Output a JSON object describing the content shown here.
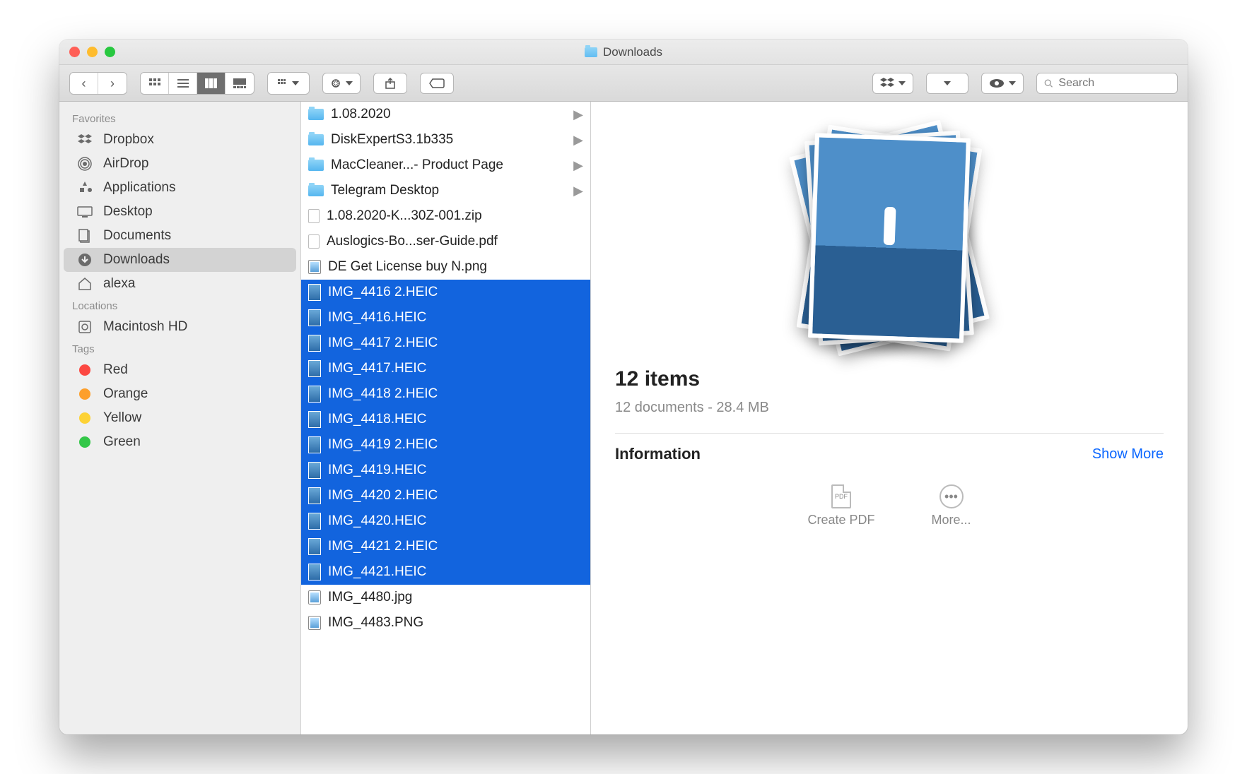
{
  "window": {
    "title": "Downloads"
  },
  "toolbar": {
    "search_placeholder": "Search"
  },
  "sidebar": {
    "sections": [
      {
        "label": "Favorites",
        "items": [
          {
            "label": "Dropbox",
            "icon": "dropbox"
          },
          {
            "label": "AirDrop",
            "icon": "airdrop"
          },
          {
            "label": "Applications",
            "icon": "apps"
          },
          {
            "label": "Desktop",
            "icon": "desktop"
          },
          {
            "label": "Documents",
            "icon": "documents"
          },
          {
            "label": "Downloads",
            "icon": "downloads",
            "active": true
          },
          {
            "label": "alexa",
            "icon": "home"
          }
        ]
      },
      {
        "label": "Locations",
        "items": [
          {
            "label": "Macintosh HD",
            "icon": "disk"
          }
        ]
      },
      {
        "label": "Tags",
        "items": [
          {
            "label": "Red",
            "icon": "tag",
            "color": "#fc4842"
          },
          {
            "label": "Orange",
            "icon": "tag",
            "color": "#fd9f2b"
          },
          {
            "label": "Yellow",
            "icon": "tag",
            "color": "#fdd235"
          },
          {
            "label": "Green",
            "icon": "tag",
            "color": "#33c748"
          }
        ]
      }
    ]
  },
  "files": [
    {
      "name": "1.08.2020",
      "type": "folder",
      "hasChildren": true
    },
    {
      "name": "DiskExpertS3.1b335",
      "type": "folder",
      "hasChildren": true
    },
    {
      "name": "MacCleaner...- Product Page",
      "type": "folder",
      "hasChildren": true
    },
    {
      "name": "Telegram Desktop",
      "type": "folder",
      "hasChildren": true
    },
    {
      "name": "1.08.2020-K...30Z-001.zip",
      "type": "zip"
    },
    {
      "name": "Auslogics-Bo...ser-Guide.pdf",
      "type": "pdf"
    },
    {
      "name": "DE Get License buy N.png",
      "type": "png"
    },
    {
      "name": "IMG_4416 2.HEIC",
      "type": "heic",
      "selected": true
    },
    {
      "name": "IMG_4416.HEIC",
      "type": "heic",
      "selected": true
    },
    {
      "name": "IMG_4417 2.HEIC",
      "type": "heic",
      "selected": true
    },
    {
      "name": "IMG_4417.HEIC",
      "type": "heic",
      "selected": true
    },
    {
      "name": "IMG_4418 2.HEIC",
      "type": "heic",
      "selected": true
    },
    {
      "name": "IMG_4418.HEIC",
      "type": "heic",
      "selected": true
    },
    {
      "name": "IMG_4419 2.HEIC",
      "type": "heic",
      "selected": true
    },
    {
      "name": "IMG_4419.HEIC",
      "type": "heic",
      "selected": true
    },
    {
      "name": "IMG_4420 2.HEIC",
      "type": "heic",
      "selected": true
    },
    {
      "name": "IMG_4420.HEIC",
      "type": "heic",
      "selected": true
    },
    {
      "name": "IMG_4421 2.HEIC",
      "type": "heic",
      "selected": true
    },
    {
      "name": "IMG_4421.HEIC",
      "type": "heic",
      "selected": true
    },
    {
      "name": "IMG_4480.jpg",
      "type": "jpg"
    },
    {
      "name": "IMG_4483.PNG",
      "type": "png"
    }
  ],
  "preview": {
    "count_label": "12 items",
    "detail_label": "12 documents - 28.4 MB",
    "info_label": "Information",
    "show_more": "Show More",
    "action_pdf": "Create PDF",
    "action_more": "More..."
  }
}
